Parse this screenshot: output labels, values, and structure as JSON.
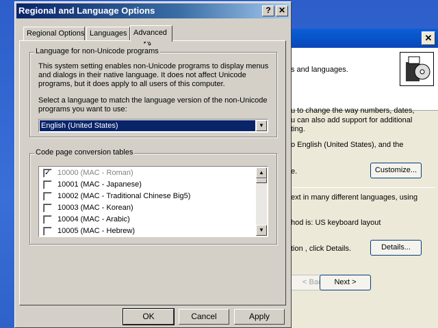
{
  "dialog": {
    "title": "Regional and Language Options",
    "help_button": "?",
    "close_button": "✕",
    "tabs": [
      {
        "label": "Regional Options"
      },
      {
        "label": "Languages"
      },
      {
        "label": "Advanced"
      }
    ],
    "non_unicode": {
      "legend": "Language for non-Unicode programs",
      "description": [
        "This system setting enables non-Unicode programs to display menus",
        "and dialogs in their native language. It does not affect Unicode",
        "programs, but it does apply to all users of this computer."
      ],
      "prompt": [
        "Select a language to match the language version of the non-Unicode",
        "programs you want to use:"
      ],
      "selected_language": "English (United States)"
    },
    "code_page": {
      "legend": "Code page conversion tables",
      "items": [
        {
          "label": "10000 (MAC - Roman)",
          "checked": true,
          "disabled": true
        },
        {
          "label": "10001 (MAC - Japanese)",
          "checked": false,
          "disabled": false
        },
        {
          "label": "10002 (MAC - Traditional Chinese Big5)",
          "checked": false,
          "disabled": false
        },
        {
          "label": "10003 (MAC - Korean)",
          "checked": false,
          "disabled": false
        },
        {
          "label": "10004 (MAC - Arabic)",
          "checked": false,
          "disabled": false
        },
        {
          "label": "10005 (MAC - Hebrew)",
          "checked": false,
          "disabled": false
        }
      ]
    },
    "buttons": {
      "ok": "OK",
      "cancel": "Cancel",
      "apply": "Apply"
    }
  },
  "background_window": {
    "close_button": "✕",
    "header_text": "s and languages.",
    "lines": [
      "u to change the way numbers, dates,",
      "u can also add support for additional",
      "ting.",
      "o English (United States), and the",
      "e.",
      "ext in many different languages, using",
      "hod is: US keyboard layout",
      "tion , click Details."
    ],
    "customize_button": "Customize...",
    "details_button": "Details...",
    "back_button": "< Back",
    "next_button": "Next >"
  },
  "colors": {
    "title_active": "#0a246a",
    "selection": "#0a246a",
    "dialog_face": "#d4d0c8",
    "desktop": "#3a6ea5"
  }
}
